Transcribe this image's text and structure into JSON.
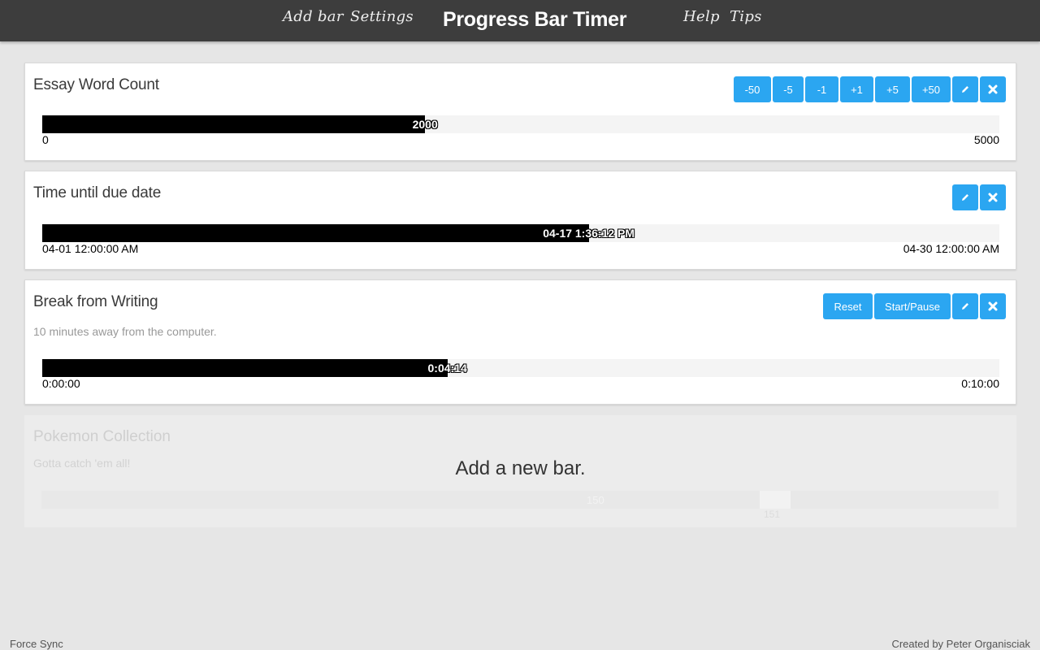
{
  "header": {
    "title": "Progress Bar Timer",
    "nav_left": [
      "Add bar",
      "Settings"
    ],
    "nav_right": [
      "Help",
      "Tips"
    ],
    "background": "#3d3d3d"
  },
  "accent_color": "#2ba6f1",
  "bars": [
    {
      "title": "Essay Word Count",
      "description": "",
      "buttons": [
        "-50",
        "-5",
        "-1",
        "+1",
        "+5",
        "+50"
      ],
      "value_label": "2000",
      "min_label": "0",
      "max_label": "5000",
      "progress": 0.4
    },
    {
      "title": "Time until due date",
      "description": "",
      "buttons": [],
      "value_label": "04-17 1:36:12 PM",
      "min_label": "04-01 12:00:00 AM",
      "max_label": "04-30 12:00:00 AM",
      "progress": 0.571
    },
    {
      "title": "Break from Writing",
      "description": "10 minutes away from the computer.",
      "buttons": [
        "Reset",
        "Start/Pause"
      ],
      "value_label": "0:04:14",
      "min_label": "0:00:00",
      "max_label": "0:10:00",
      "progress": 0.4233
    }
  ],
  "ghost_card": {
    "title": "Pokemon Collection",
    "description": "Gotta catch 'em all!",
    "value_label": "150",
    "max_label": "151",
    "overlay_text": "Add a new bar."
  },
  "footer": {
    "left": "Force Sync",
    "right": "Created by Peter Organisciak"
  },
  "icons": {
    "edit": "pencil-icon",
    "delete": "close-icon"
  }
}
